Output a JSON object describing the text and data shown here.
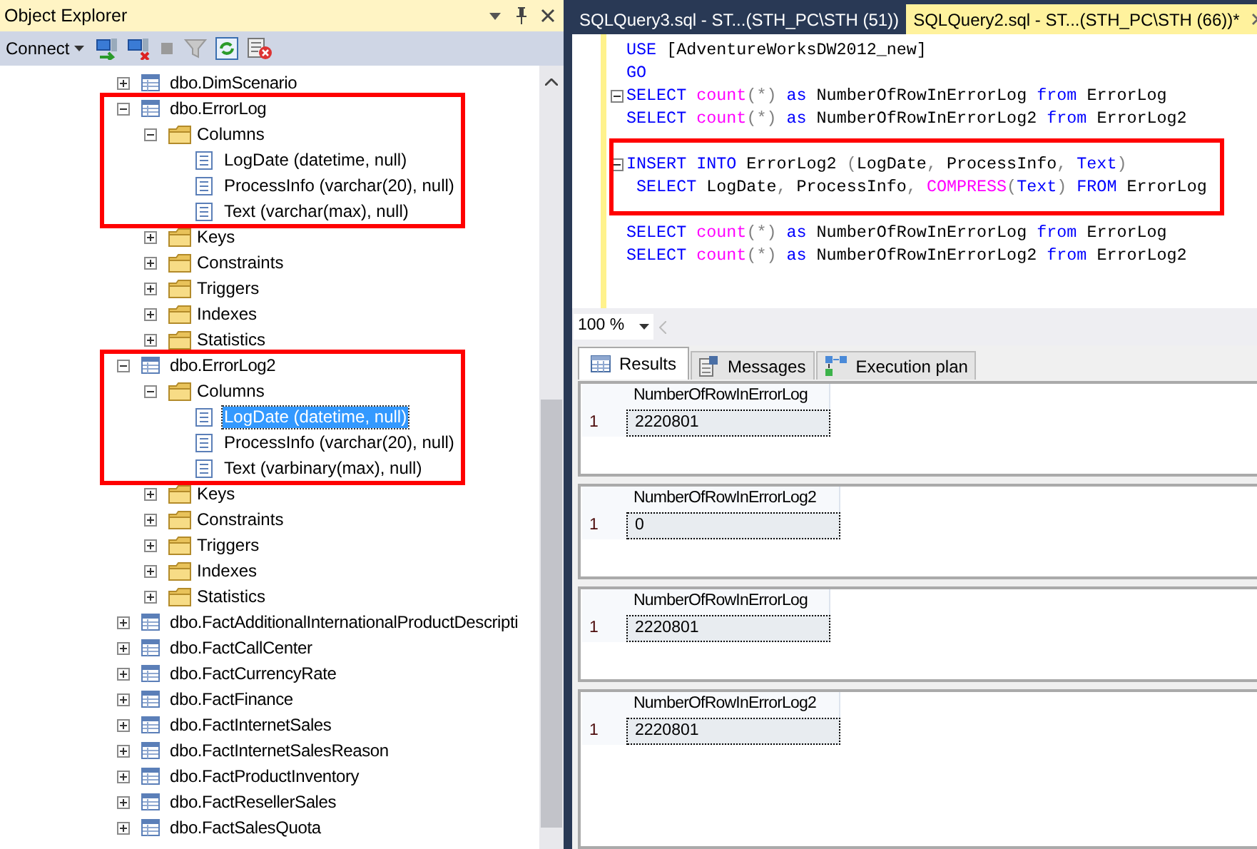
{
  "object_explorer": {
    "title": "Object Explorer",
    "connect": "Connect",
    "tree": [
      {
        "label": "dbo.DimScenario",
        "kind": "table",
        "expanded": false,
        "selected": false,
        "highlighted": false
      },
      {
        "label": "dbo.ErrorLog",
        "kind": "table",
        "expanded": true,
        "selected": false,
        "highlighted": true,
        "children": [
          {
            "label": "Columns",
            "kind": "folder",
            "expanded": true,
            "selected": false,
            "children": [
              {
                "label": "LogDate (datetime, null)",
                "kind": "column",
                "selected": false
              },
              {
                "label": "ProcessInfo (varchar(20), null)",
                "kind": "column",
                "selected": false
              },
              {
                "label": "Text (varchar(max), null)",
                "kind": "column",
                "selected": false
              }
            ]
          },
          {
            "label": "Keys",
            "kind": "folder",
            "expanded": false,
            "selected": false
          },
          {
            "label": "Constraints",
            "kind": "folder",
            "expanded": false,
            "selected": false
          },
          {
            "label": "Triggers",
            "kind": "folder",
            "expanded": false,
            "selected": false
          },
          {
            "label": "Indexes",
            "kind": "folder",
            "expanded": false,
            "selected": false
          },
          {
            "label": "Statistics",
            "kind": "folder",
            "expanded": false,
            "selected": false
          }
        ]
      },
      {
        "label": "dbo.ErrorLog2",
        "kind": "table",
        "expanded": true,
        "selected": false,
        "highlighted": true,
        "children": [
          {
            "label": "Columns",
            "kind": "folder",
            "expanded": true,
            "selected": false,
            "children": [
              {
                "label": "LogDate (datetime, null)",
                "kind": "column",
                "selected": true
              },
              {
                "label": "ProcessInfo (varchar(20), null)",
                "kind": "column",
                "selected": false
              },
              {
                "label": "Text (varbinary(max), null)",
                "kind": "column",
                "selected": false
              }
            ]
          },
          {
            "label": "Keys",
            "kind": "folder",
            "expanded": false,
            "selected": false
          },
          {
            "label": "Constraints",
            "kind": "folder",
            "expanded": false,
            "selected": false
          },
          {
            "label": "Triggers",
            "kind": "folder",
            "expanded": false,
            "selected": false
          },
          {
            "label": "Indexes",
            "kind": "folder",
            "expanded": false,
            "selected": false
          },
          {
            "label": "Statistics",
            "kind": "folder",
            "expanded": false,
            "selected": false
          }
        ]
      },
      {
        "label": "dbo.FactAdditionalInternationalProductDescripti",
        "kind": "table",
        "expanded": false,
        "selected": false,
        "highlighted": false
      },
      {
        "label": "dbo.FactCallCenter",
        "kind": "table",
        "expanded": false,
        "selected": false,
        "highlighted": false
      },
      {
        "label": "dbo.FactCurrencyRate",
        "kind": "table",
        "expanded": false,
        "selected": false,
        "highlighted": false
      },
      {
        "label": "dbo.FactFinance",
        "kind": "table",
        "expanded": false,
        "selected": false,
        "highlighted": false
      },
      {
        "label": "dbo.FactInternetSales",
        "kind": "table",
        "expanded": false,
        "selected": false,
        "highlighted": false
      },
      {
        "label": "dbo.FactInternetSalesReason",
        "kind": "table",
        "expanded": false,
        "selected": false,
        "highlighted": false
      },
      {
        "label": "dbo.FactProductInventory",
        "kind": "table",
        "expanded": false,
        "selected": false,
        "highlighted": false
      },
      {
        "label": "dbo.FactResellerSales",
        "kind": "table",
        "expanded": false,
        "selected": false,
        "highlighted": false
      },
      {
        "label": "dbo.FactSalesQuota",
        "kind": "table",
        "expanded": false,
        "selected": false,
        "highlighted": false
      }
    ]
  },
  "editor": {
    "tabs": [
      {
        "label": "SQLQuery3.sql - ST...(STH_PC\\STH (51))",
        "selected": false
      },
      {
        "label": "SQLQuery2.sql - ST...(STH_PC\\STH (66))*",
        "selected": true
      }
    ],
    "blocks": [
      {
        "highlighted": false,
        "lines": [
          {
            "fold": false,
            "tokens": [
              {
                "text": "USE ",
                "kind": "keyword"
              },
              {
                "text": "[AdventureWorksDW2012_new]",
                "kind": "plain"
              }
            ]
          },
          {
            "fold": false,
            "tokens": [
              {
                "text": "GO",
                "kind": "keyword"
              }
            ]
          },
          {
            "fold": true,
            "tokens": [
              {
                "text": "SELECT ",
                "kind": "keyword"
              },
              {
                "text": "count",
                "kind": "function"
              },
              {
                "text": "(*)",
                "kind": "operator"
              },
              {
                "text": " as ",
                "kind": "keyword"
              },
              {
                "text": "NumberOfRowInErrorLog ",
                "kind": "plain"
              },
              {
                "text": "from ",
                "kind": "keyword"
              },
              {
                "text": "ErrorLog",
                "kind": "plain"
              }
            ]
          },
          {
            "fold": false,
            "tokens": [
              {
                "text": "SELECT ",
                "kind": "keyword"
              },
              {
                "text": "count",
                "kind": "function"
              },
              {
                "text": "(*)",
                "kind": "operator"
              },
              {
                "text": " as ",
                "kind": "keyword"
              },
              {
                "text": "NumberOfRowInErrorLog2 ",
                "kind": "plain"
              },
              {
                "text": "from ",
                "kind": "keyword"
              },
              {
                "text": "ErrorLog2",
                "kind": "plain"
              }
            ]
          }
        ]
      },
      {
        "highlighted": true,
        "lines": [
          {
            "fold": true,
            "tokens": [
              {
                "text": "INSERT INTO ",
                "kind": "keyword"
              },
              {
                "text": "ErrorLog2 ",
                "kind": "plain"
              },
              {
                "text": "(",
                "kind": "operator"
              },
              {
                "text": "LogDate",
                "kind": "plain"
              },
              {
                "text": ", ",
                "kind": "operator"
              },
              {
                "text": "ProcessInfo",
                "kind": "plain"
              },
              {
                "text": ", ",
                "kind": "operator"
              },
              {
                "text": "Text",
                "kind": "keyword"
              },
              {
                "text": ")",
                "kind": "operator"
              }
            ]
          },
          {
            "fold": false,
            "tokens": [
              {
                "text": " SELECT ",
                "kind": "keyword"
              },
              {
                "text": "LogDate",
                "kind": "plain"
              },
              {
                "text": ", ",
                "kind": "operator"
              },
              {
                "text": "ProcessInfo",
                "kind": "plain"
              },
              {
                "text": ", ",
                "kind": "operator"
              },
              {
                "text": "COMPRESS",
                "kind": "function"
              },
              {
                "text": "(",
                "kind": "operator"
              },
              {
                "text": "Text",
                "kind": "keyword"
              },
              {
                "text": ") ",
                "kind": "operator"
              },
              {
                "text": "FROM ",
                "kind": "keyword"
              },
              {
                "text": "ErrorLog",
                "kind": "plain"
              }
            ]
          }
        ]
      },
      {
        "highlighted": false,
        "lines": [
          {
            "fold": false,
            "tokens": [
              {
                "text": "SELECT ",
                "kind": "keyword"
              },
              {
                "text": "count",
                "kind": "function"
              },
              {
                "text": "(*)",
                "kind": "operator"
              },
              {
                "text": " as ",
                "kind": "keyword"
              },
              {
                "text": "NumberOfRowInErrorLog ",
                "kind": "plain"
              },
              {
                "text": "from ",
                "kind": "keyword"
              },
              {
                "text": "ErrorLog",
                "kind": "plain"
              }
            ]
          },
          {
            "fold": false,
            "tokens": [
              {
                "text": "SELECT ",
                "kind": "keyword"
              },
              {
                "text": "count",
                "kind": "function"
              },
              {
                "text": "(*)",
                "kind": "operator"
              },
              {
                "text": " as ",
                "kind": "keyword"
              },
              {
                "text": "NumberOfRowInErrorLog2 ",
                "kind": "plain"
              },
              {
                "text": "from ",
                "kind": "keyword"
              },
              {
                "text": "ErrorLog2",
                "kind": "plain"
              }
            ]
          }
        ]
      }
    ],
    "zoom": "100 %"
  },
  "results": {
    "tabs": [
      {
        "label": "Results",
        "kind": "grid",
        "selected": true
      },
      {
        "label": "Messages",
        "kind": "messages",
        "selected": false
      },
      {
        "label": "Execution plan",
        "kind": "plan",
        "selected": false
      }
    ],
    "grids": [
      {
        "column": "NumberOfRowInErrorLog",
        "row_number": "1",
        "value": "2220801"
      },
      {
        "column": "NumberOfRowInErrorLog2",
        "row_number": "1",
        "value": "0"
      },
      {
        "column": "NumberOfRowInErrorLog",
        "row_number": "1",
        "value": "2220801"
      },
      {
        "column": "NumberOfRowInErrorLog2",
        "row_number": "1",
        "value": "2220801"
      }
    ]
  }
}
